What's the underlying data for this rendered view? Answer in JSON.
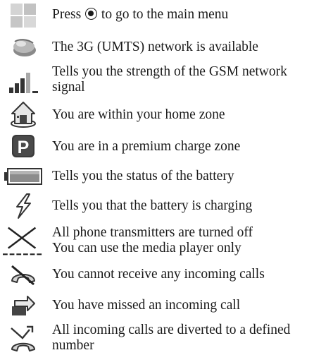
{
  "items": [
    {
      "icon": "main-menu-grid-icon",
      "line1_a": "Press",
      "line1_b": "to go to the main menu"
    },
    {
      "icon": "3g-umts-network-icon",
      "line1": "The 3G (UMTS) network is available"
    },
    {
      "icon": "signal-strength-icon",
      "line1": "Tells you the strength of the GSM network",
      "line2": "signal"
    },
    {
      "icon": "home-zone-icon",
      "line1": "You are within your home zone"
    },
    {
      "icon": "premium-charge-zone-icon",
      "line1": "You are in a premium charge zone"
    },
    {
      "icon": "battery-status-icon",
      "line1": "Tells you the status of the battery"
    },
    {
      "icon": "battery-charging-icon",
      "line1": "Tells you that the battery is charging"
    },
    {
      "icon": "flight-mode-icon",
      "line1": "All phone transmitters are turned off",
      "line2": "You can use the media player only"
    },
    {
      "icon": "no-incoming-calls-icon",
      "line1": "You cannot receive any incoming calls"
    },
    {
      "icon": "missed-call-icon",
      "line1": "You have missed an incoming call"
    },
    {
      "icon": "call-divert-icon",
      "line1": "All incoming calls are diverted to a defined",
      "line2": "number"
    }
  ],
  "colors": {
    "icon_dark": "#333333",
    "icon_mid": "#8a8a8a",
    "icon_light": "#cfcfcf",
    "text": "#1a1a1a"
  }
}
